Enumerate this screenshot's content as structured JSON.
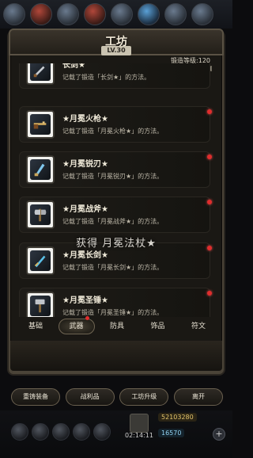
{
  "window": {
    "title": "工坊",
    "level_badge": "LV.30",
    "smith_level_label": "锻造等级:120",
    "smith_progress": 1.0
  },
  "status_code": "",
  "recipes": [
    {
      "name": "长剑★",
      "desc": "记载了锻造「长剑★」的方法。",
      "icon": "longsword-icon",
      "has_new": false
    },
    {
      "name": "★月冕火枪★",
      "desc": "记载了锻造「月冕火枪★」的方法。",
      "icon": "musket-icon",
      "has_new": true
    },
    {
      "name": "★月冕锐刃★",
      "desc": "记载了锻造「月冕锐刃★」的方法。",
      "icon": "blade-icon",
      "has_new": true
    },
    {
      "name": "★月冕战斧★",
      "desc": "记载了锻造「月冕战斧★」的方法。",
      "icon": "axe-icon",
      "has_new": true
    },
    {
      "name": "★月冕长剑★",
      "desc": "记载了锻造「月冕长剑★」的方法。",
      "icon": "sword-icon",
      "has_new": true
    },
    {
      "name": "★月冕圣锤★",
      "desc": "记载了锻造「月冕圣锤★」的方法。",
      "icon": "hammer-icon",
      "has_new": true
    }
  ],
  "toast": "获得 月冕法杖★",
  "tabs": [
    {
      "label": "基础",
      "active": false,
      "has_new": false
    },
    {
      "label": "武器",
      "active": true,
      "has_new": true
    },
    {
      "label": "防具",
      "active": false,
      "has_new": false
    },
    {
      "label": "饰品",
      "active": false,
      "has_new": false
    },
    {
      "label": "符文",
      "active": false,
      "has_new": false
    }
  ],
  "buttons": [
    {
      "label": "重铸装备"
    },
    {
      "label": "战利品"
    },
    {
      "label": "工坊升级"
    },
    {
      "label": "离开"
    }
  ],
  "bottom_hud": {
    "clock": "02:14:11",
    "resource_1": "52103280",
    "resource_2": "16570",
    "plus_label": "+"
  },
  "colors": {
    "new_dot": "#e02d2d",
    "panel": "#1a1814"
  }
}
